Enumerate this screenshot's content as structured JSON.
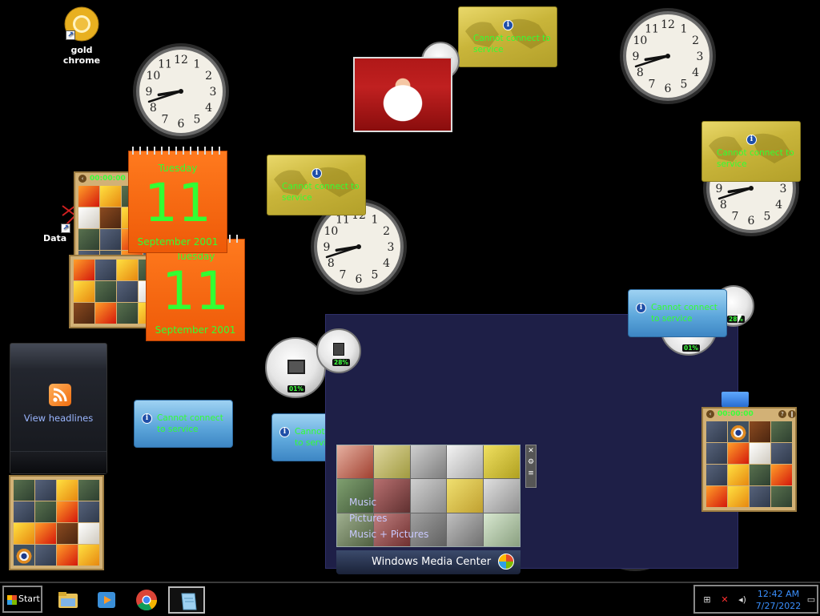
{
  "desktop_icons": {
    "gold_chrome": "gold chrome",
    "data": "Data"
  },
  "calendar_front": {
    "weekday": "Tuesday",
    "day": "11",
    "month_year": "September 2001"
  },
  "calendar_back": {
    "weekday": "Tuesday",
    "day": "11",
    "month_year": "September 2001"
  },
  "service_message": "Cannot connect to service",
  "puzzle": {
    "timer": "00:00:00"
  },
  "feed": {
    "label": "View headlines"
  },
  "meters": {
    "cpu_a": "01%",
    "mem_a": "28%",
    "cpu_b": "01%",
    "mem_b": "28%"
  },
  "media_center": {
    "menu": [
      "Music",
      "Pictures",
      "Music + Pictures"
    ],
    "brand": "Windows Media Center"
  },
  "taskbar": {
    "start_label": "Start",
    "pinned": [
      "file-explorer-icon",
      "windows-media-player-icon",
      "chrome-icon",
      "notepad-icon"
    ],
    "clock_time": "12:42 AM",
    "clock_date": "7/27/2022"
  },
  "colors": {
    "desktop_bg": "#000000",
    "panel_bg": "#1e1f47",
    "accent_text": "#33ff33",
    "tray_text": "#3a90ff"
  }
}
